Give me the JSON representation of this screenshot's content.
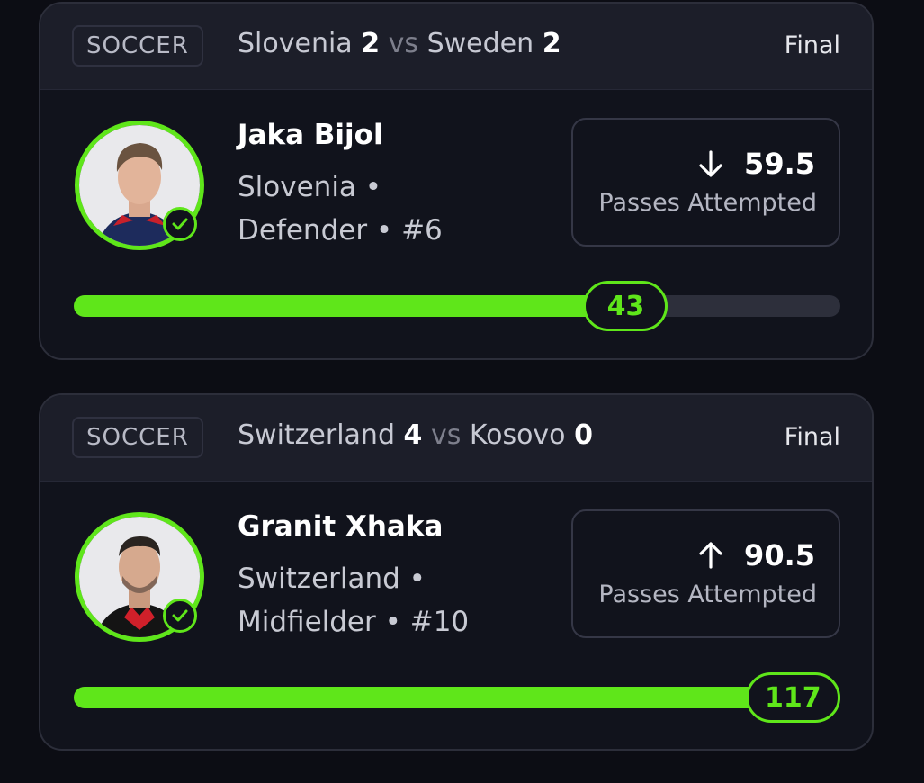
{
  "cards": [
    {
      "sport": "SOCCER",
      "home_team": "Slovenia",
      "home_score": "2",
      "vs": "vs",
      "away_team": "Sweden",
      "away_score": "2",
      "status": "Final",
      "player": {
        "name": "Jaka Bijol",
        "line1": "Slovenia •",
        "line2": "Defender • #6"
      },
      "prop": {
        "direction": "under",
        "arrow_icon": "arrow-down-icon",
        "line": "59.5",
        "stat": "Passes Attempted"
      },
      "progress": {
        "actual": "43",
        "fraction": 0.72
      }
    },
    {
      "sport": "SOCCER",
      "home_team": "Switzerland",
      "home_score": "4",
      "vs": "vs",
      "away_team": "Kosovo",
      "away_score": "0",
      "status": "Final",
      "player": {
        "name": "Granit Xhaka",
        "line1": "Switzerland •",
        "line2": "Midfielder • #10"
      },
      "prop": {
        "direction": "over",
        "arrow_icon": "arrow-up-icon",
        "line": "90.5",
        "stat": "Passes Attempted"
      },
      "progress": {
        "actual": "117",
        "fraction": 1.0
      }
    }
  ],
  "colors": {
    "accent": "#5fe61a",
    "background": "#0c0d14",
    "card": "#11131c",
    "header": "#1c1e29"
  }
}
